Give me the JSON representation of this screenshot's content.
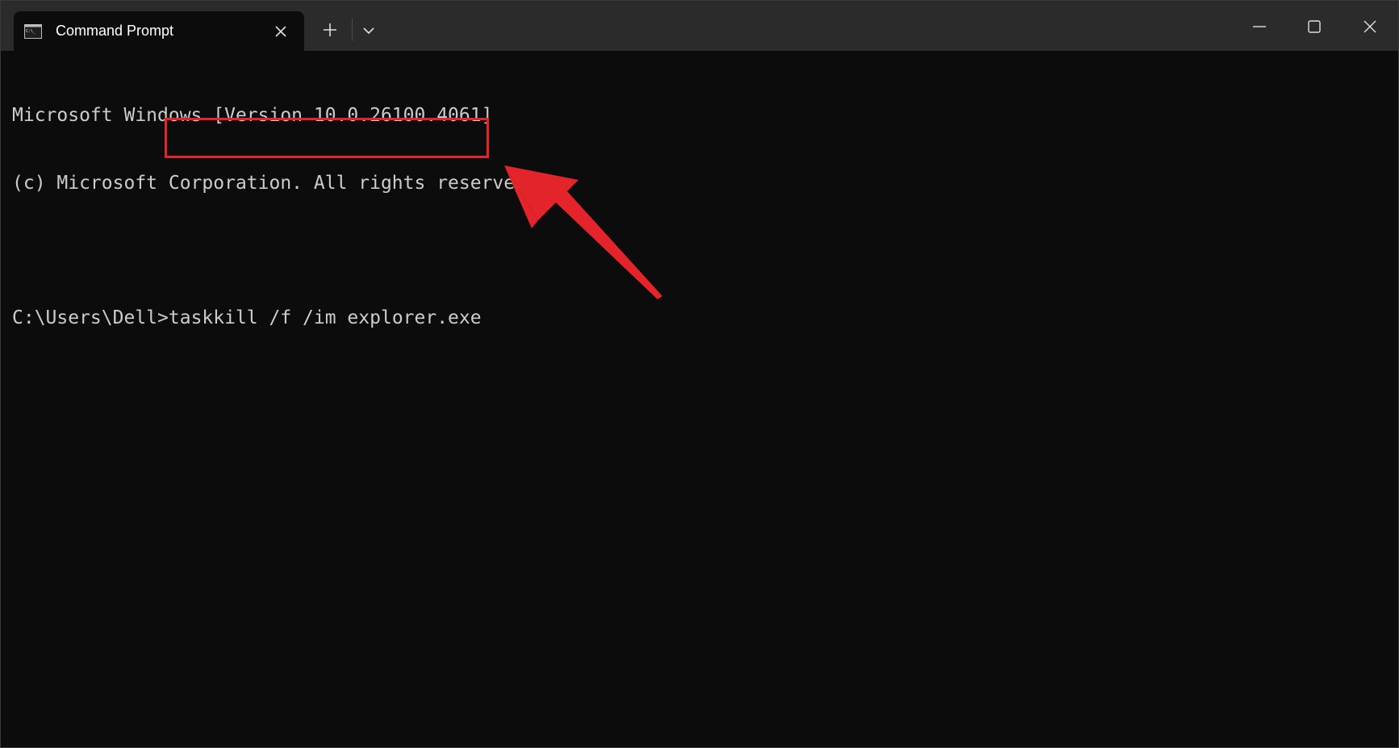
{
  "window": {
    "tab_title": "Command Prompt",
    "icons": {
      "tab": "command-prompt-icon",
      "close_tab": "close-icon",
      "new_tab": "plus-icon",
      "dropdown": "chevron-down-icon",
      "minimize": "minimize-icon",
      "maximize": "maximize-icon",
      "close_window": "close-icon"
    }
  },
  "terminal": {
    "lines": [
      "Microsoft Windows [Version 10.0.26100.4061]",
      "(c) Microsoft Corporation. All rights reserved."
    ],
    "prompt": "C:\\Users\\Dell>",
    "command": "taskkill /f /im explorer.exe"
  },
  "annotation": {
    "highlight_color": "#e3242b",
    "arrow_color": "#e3242b"
  },
  "colors": {
    "terminal_bg": "#0c0c0c",
    "titlebar_bg": "#2b2b2b",
    "text": "#cccccc"
  }
}
